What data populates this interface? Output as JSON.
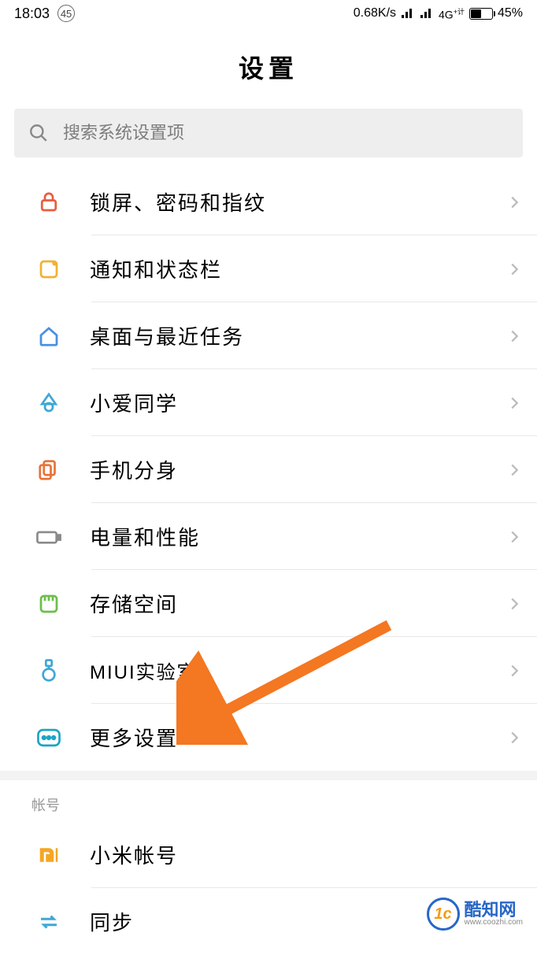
{
  "status_bar": {
    "time": "18:03",
    "step": "45",
    "speed": "0.68K/s",
    "network": "4G",
    "network_suffix": "+计",
    "battery_pct": "45%"
  },
  "title": "设置",
  "search": {
    "placeholder": "搜索系统设置项"
  },
  "sections": {
    "main": [
      {
        "id": "lock",
        "label": "锁屏、密码和指纹"
      },
      {
        "id": "notif",
        "label": "通知和状态栏"
      },
      {
        "id": "desktop",
        "label": "桌面与最近任务"
      },
      {
        "id": "xiaoai",
        "label": "小爱同学"
      },
      {
        "id": "clone",
        "label": "手机分身"
      },
      {
        "id": "battery",
        "label": "电量和性能"
      },
      {
        "id": "storage",
        "label": "存储空间"
      },
      {
        "id": "lab",
        "label": "MIUI实验室"
      },
      {
        "id": "more",
        "label": "更多设置"
      }
    ],
    "account_header": "帐号",
    "account": [
      {
        "id": "mi",
        "label": "小米帐号"
      },
      {
        "id": "sync",
        "label": "同步"
      }
    ]
  },
  "watermark": {
    "brand": "酷知网",
    "url": "www.coozhi.com"
  }
}
